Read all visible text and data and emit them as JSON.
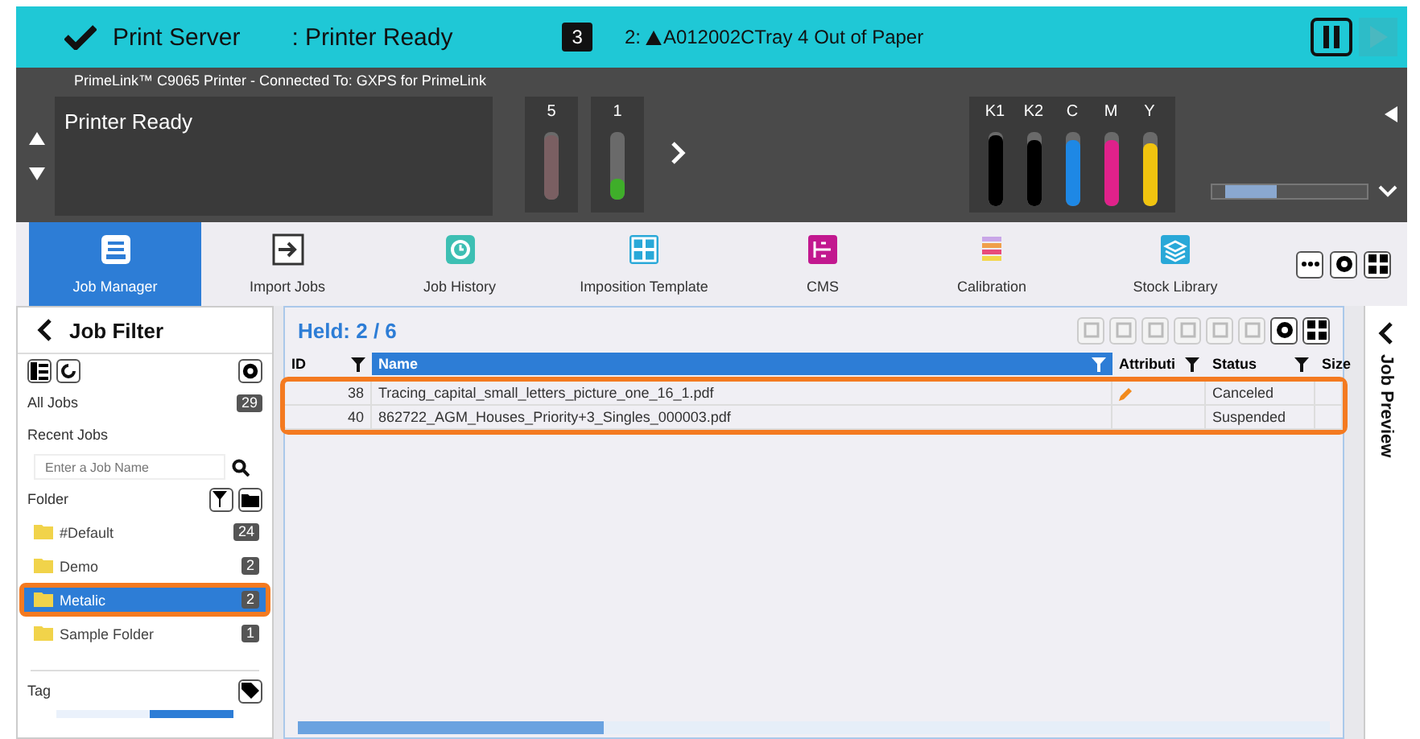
{
  "header": {
    "title": "Print Server",
    "status": ": Printer Ready",
    "alert_count": "3",
    "alert_prefix": "2:",
    "alert": "A012002CTray 4 Out of Paper"
  },
  "printer": {
    "connection": "PrimeLink™ C9065 Printer - Connected To: GXPS for PrimeLink",
    "message": "Printer Ready",
    "trays": [
      {
        "label": "5",
        "level": 0.95,
        "color": "#7a5f62"
      },
      {
        "label": "1",
        "level": 0.3,
        "color": "#3fae2a"
      }
    ],
    "inks": [
      {
        "label": "K1",
        "level": 0.95,
        "color": "#000000"
      },
      {
        "label": "K2",
        "level": 0.9,
        "color": "#000000"
      },
      {
        "label": "C",
        "level": 0.9,
        "color": "#1e88e5"
      },
      {
        "label": "M",
        "level": 0.9,
        "color": "#e0218a"
      },
      {
        "label": "Y",
        "level": 0.85,
        "color": "#f1c40f"
      }
    ]
  },
  "tabs": [
    {
      "label": "Job Manager",
      "kind": "manager",
      "selected": true
    },
    {
      "label": "Import Jobs",
      "kind": "import",
      "selected": false
    },
    {
      "label": "Job History",
      "kind": "history",
      "selected": false
    },
    {
      "label": "Imposition Template",
      "kind": "imposition",
      "selected": false
    },
    {
      "label": "CMS",
      "kind": "cms",
      "selected": false
    },
    {
      "label": "Calibration",
      "kind": "calibration",
      "selected": false
    },
    {
      "label": "Stock Library",
      "kind": "library",
      "selected": false
    }
  ],
  "sidebar": {
    "title": "Job Filter",
    "all_jobs": {
      "label": "All Jobs",
      "count": "29"
    },
    "recent": "Recent Jobs",
    "search": {
      "placeholder": "Enter a Job Name"
    },
    "folder_label": "Folder",
    "folders": [
      {
        "name": "#Default",
        "count": "24",
        "selected": false
      },
      {
        "name": "Demo",
        "count": "2",
        "selected": false
      },
      {
        "name": "Metalic",
        "count": "2",
        "selected": true
      },
      {
        "name": "Sample Folder",
        "count": "1",
        "selected": false
      }
    ],
    "tag_label": "Tag"
  },
  "jobs": {
    "title": "Held: 2 / 6",
    "columns": [
      {
        "label": "ID",
        "selected": false
      },
      {
        "label": "Name",
        "selected": true
      },
      {
        "label": "Attributi",
        "selected": false
      },
      {
        "label": "Status",
        "selected": false
      },
      {
        "label": "Size",
        "selected": false
      }
    ],
    "rows": [
      {
        "id": "38",
        "name": "Tracing_capital_small_letters_picture_one_16_1.pdf",
        "edited": true,
        "status": "Canceled"
      },
      {
        "id": "40",
        "name": "862722_AGM_Houses_Priority+3_Singles_000003.pdf",
        "edited": false,
        "status": "Suspended"
      }
    ]
  },
  "preview": {
    "title": "Job Preview"
  }
}
